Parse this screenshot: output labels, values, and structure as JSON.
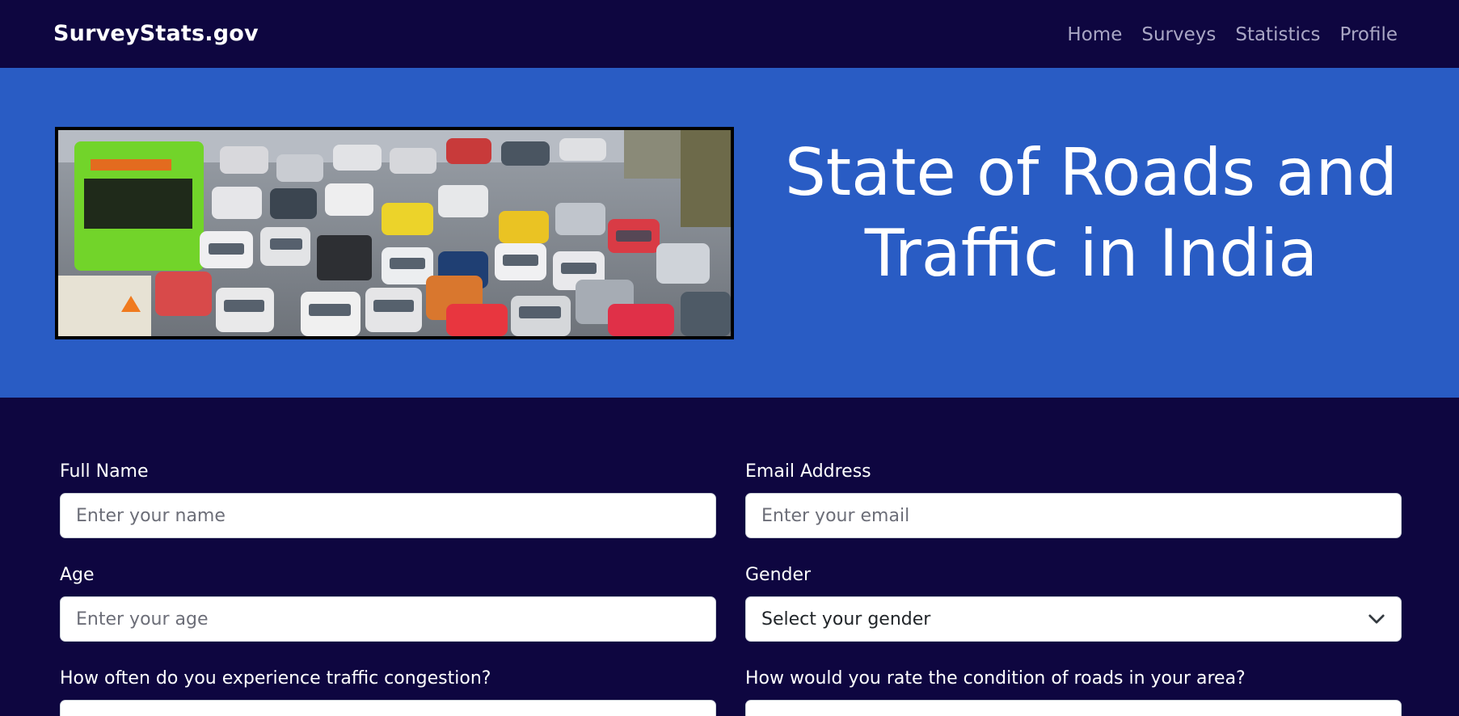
{
  "navbar": {
    "brand": "SurveyStats.gov",
    "links": [
      "Home",
      "Surveys",
      "Statistics",
      "Profile"
    ]
  },
  "hero": {
    "title_line1": "State of Roads and",
    "title_line2": "Traffic in India",
    "image": "traffic-congestion-photo"
  },
  "form": {
    "full_name": {
      "label": "Full Name",
      "placeholder": "Enter your name"
    },
    "email": {
      "label": "Email Address",
      "placeholder": "Enter your email"
    },
    "age": {
      "label": "Age",
      "placeholder": "Enter your age"
    },
    "gender": {
      "label": "Gender",
      "selected": "Select your gender"
    },
    "congestion": {
      "label": "How often do you experience traffic congestion?"
    },
    "road_condition": {
      "label": "How would you rate the condition of roads in your area?"
    }
  },
  "colors": {
    "navy": "#0e0640",
    "hero_blue": "#295cc4",
    "nav_link": "#a9a6c4"
  }
}
